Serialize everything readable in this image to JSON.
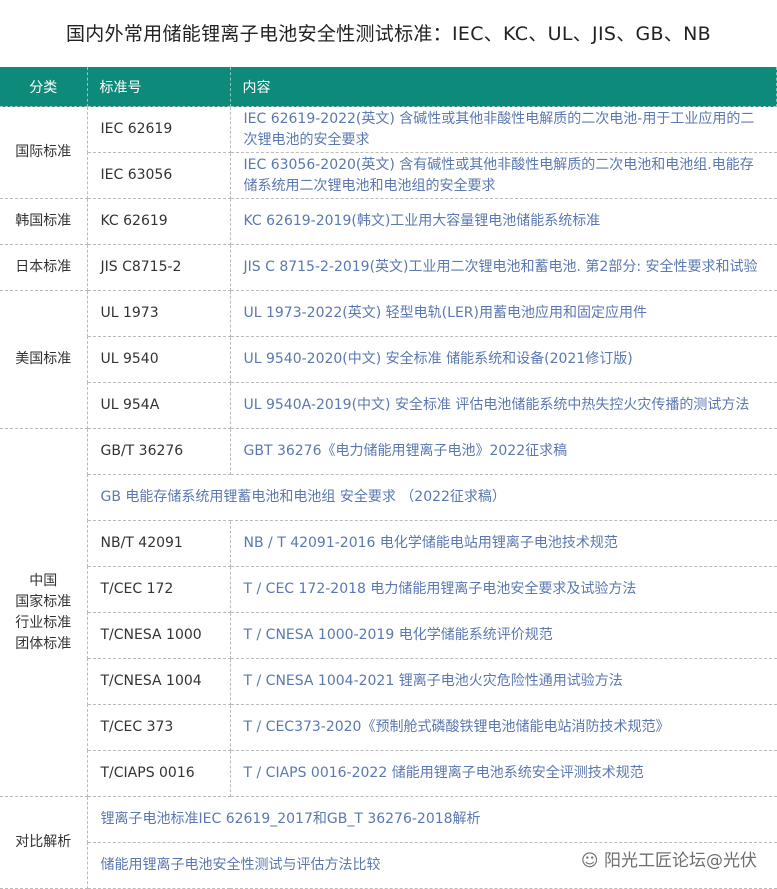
{
  "title": "国内外常用储能锂离子电池安全性测试标准：IEC、KC、UL、JIS、GB、NB",
  "headers": [
    "分类",
    "标准号",
    "内容"
  ],
  "groups": {
    "intl": "国际标准",
    "kr": "韩国标准",
    "jp": "日本标准",
    "us": "美国标准",
    "cn": "中国\n国家标准\n行业标准\n团体标准",
    "cmp": "对比解析"
  },
  "rows": [
    {
      "code": "IEC 62619",
      "content": "IEC 62619-2022(英文) 含碱性或其他非酸性电解质的二次电池-用于工业应用的二次锂电池的安全要求"
    },
    {
      "code": "IEC 63056",
      "content": "IEC 63056-2020(英文) 含有碱性或其他非酸性电解质的二次电池和电池组.电能存储系统用二次锂电池和电池组的安全要求"
    },
    {
      "code": "KC 62619",
      "content": "KC 62619-2019(韩文)工业用大容量锂电池储能系统标准"
    },
    {
      "code": "JIS C8715-2",
      "content": "JIS C 8715-2-2019(英文)工业用二次锂电池和蓄电池. 第2部分: 安全性要求和试验"
    },
    {
      "code": "UL 1973",
      "content": "UL 1973-2022(英文) 轻型电轨(LER)用蓄电池应用和固定应用件"
    },
    {
      "code": "UL 9540",
      "content": "UL 9540-2020(中文) 安全标准 储能系统和设备(2021修订版)"
    },
    {
      "code": "UL 954A",
      "content": "UL 9540A-2019(中文) 安全标准 评估电池储能系统中热失控火灾传播的测试方法"
    },
    {
      "code": "GB/T 36276",
      "content": "GBT 36276《电力储能用锂离子电池》2022征求稿"
    },
    {
      "code": "",
      "content": "GB 电能存储系统用锂蓄电池和电池组 安全要求 （2022征求稿）"
    },
    {
      "code": "NB/T 42091",
      "content": "NB / T 42091-2016 电化学储能电站用锂离子电池技术规范"
    },
    {
      "code": "T/CEC 172",
      "content": "T / CEC 172-2018 电力储能用锂离子电池安全要求及试验方法"
    },
    {
      "code": "T/CNESA 1000",
      "content": "T / CNESA 1000-2019 电化学储能系统评价规范"
    },
    {
      "code": "T/CNESA 1004",
      "content": "T / CNESA 1004-2021 锂离子电池火灾危险性通用试验方法"
    },
    {
      "code": "T/CEC 373",
      "content": "T / CEC373-2020《预制舱式磷酸铁锂电池储能电站消防技术规范》"
    },
    {
      "code": "T/CIAPS 0016",
      "content": "T / CIAPS 0016-2022 储能用锂离子电池系统安全评测技术规范"
    },
    {
      "code": "",
      "content": "锂离子电池标准IEC 62619_2017和GB_T 36276-2018解析"
    },
    {
      "code": "",
      "content": "储能用锂离子电池安全性测试与评估方法比较"
    }
  ],
  "watermark": "阳光工匠论坛@光伏"
}
